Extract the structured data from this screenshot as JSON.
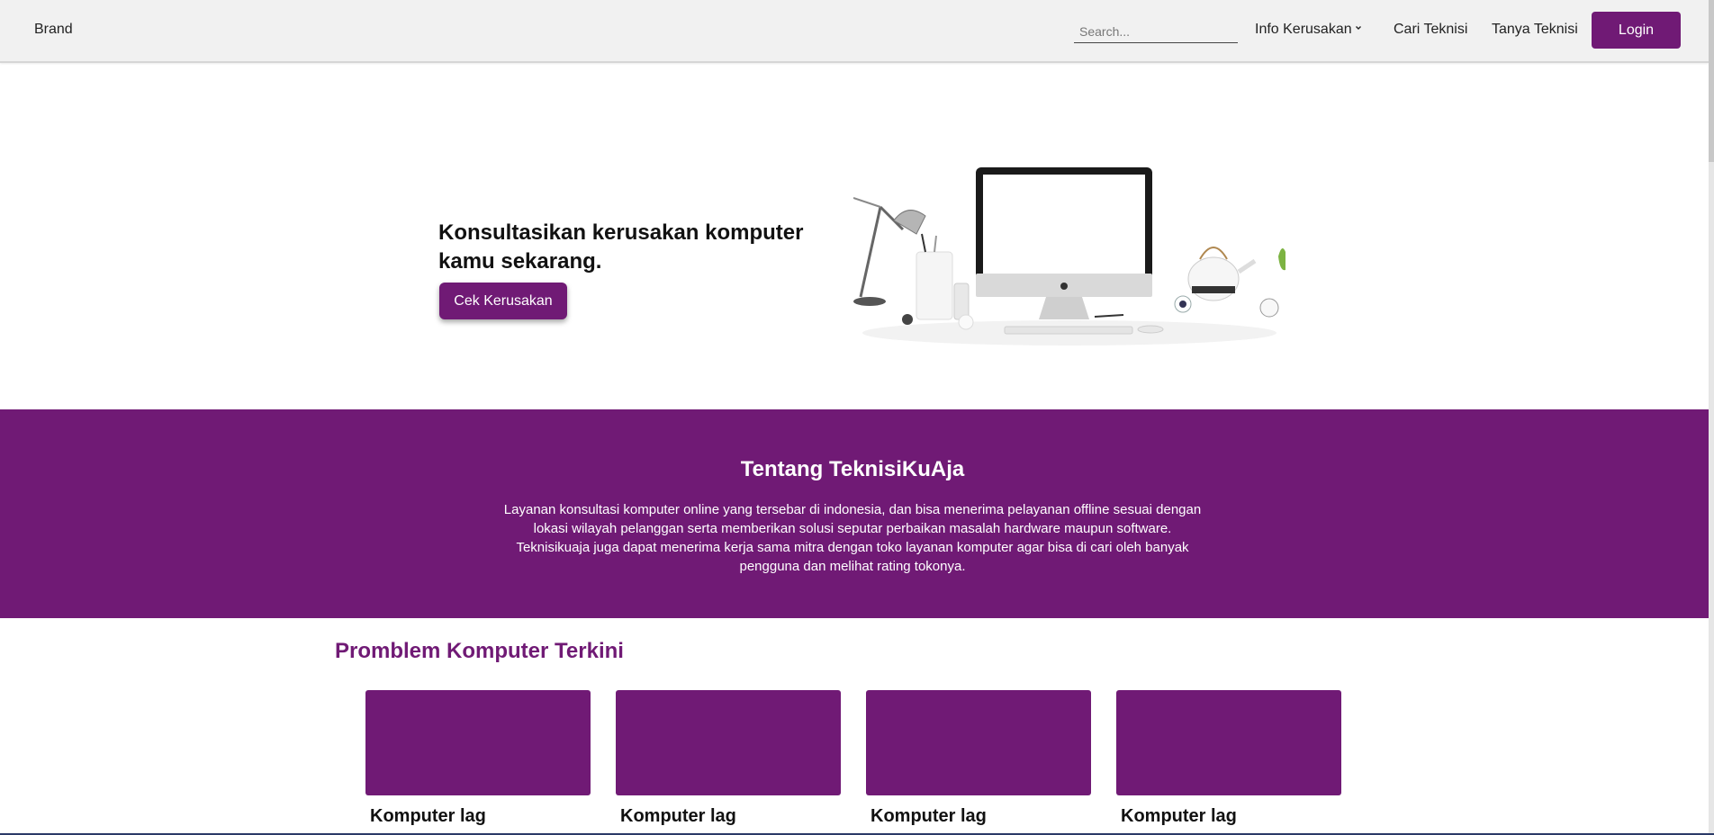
{
  "navbar": {
    "brand": "Brand",
    "search_placeholder": "Search...",
    "items": [
      {
        "label": "Info Kerusakan",
        "has_dropdown": true
      },
      {
        "label": "Cari Teknisi"
      },
      {
        "label": "Tanya Teknisi"
      }
    ],
    "login_label": "Login"
  },
  "hero": {
    "title": "Konsultasikan kerusakan komputer kamu sekarang.",
    "button_label": "Cek Kerusakan"
  },
  "about": {
    "title": "Tentang TeknisiKuAja",
    "text": "Layanan konsultasi komputer online yang tersebar di indonesia, dan bisa menerima pelayanan offline sesuai dengan lokasi wilayah pelanggan serta memberikan solusi seputar perbaikan masalah hardware maupun software. Teknisikuaja juga dapat menerima kerja sama mitra dengan toko layanan komputer agar bisa di cari oleh banyak pengguna dan melihat rating tokonya."
  },
  "problems": {
    "title": "Promblem Komputer Terkini",
    "cards": [
      {
        "title": "Komputer lag"
      },
      {
        "title": "Komputer lag"
      },
      {
        "title": "Komputer lag"
      },
      {
        "title": "Komputer lag"
      }
    ]
  },
  "colors": {
    "accent": "#701a75",
    "navbar_bg": "#f1f1f1"
  }
}
